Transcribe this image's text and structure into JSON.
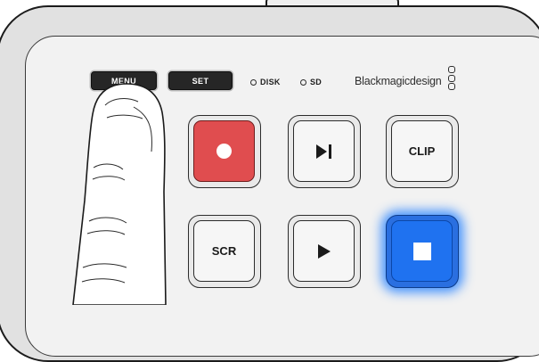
{
  "top_buttons": {
    "menu_label": "MENU",
    "set_label": "SET"
  },
  "indicators": [
    {
      "label": "DISK"
    },
    {
      "label": "SD"
    }
  ],
  "brand": {
    "name": "Blackmagicdesign"
  },
  "keys": {
    "record_icon": "record-icon",
    "skip_icon": "skip-next-icon",
    "clip_label": "CLIP",
    "scr_label": "SCR",
    "play_icon": "play-icon",
    "stop_icon": "stop-icon"
  },
  "colors": {
    "record": "#e04d4f",
    "stop_glow": "#1f72f0",
    "panel": "#f2f2f2",
    "button_dark": "#262626"
  },
  "states": {
    "stop_button_lit": true
  }
}
